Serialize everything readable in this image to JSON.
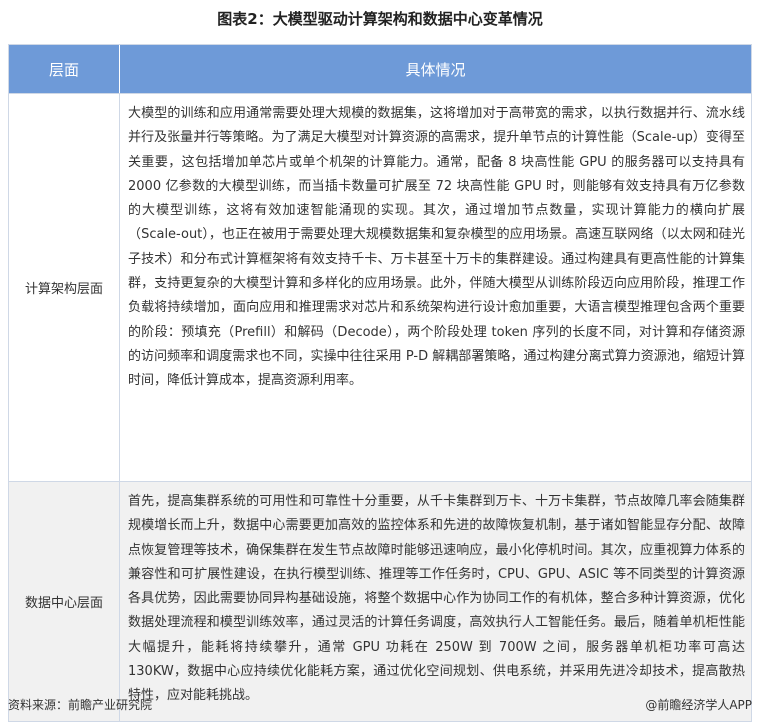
{
  "title": "图表2：大模型驱动计算架构和数据中心变革情况",
  "header": {
    "col1": "层面",
    "col2": "具体情况"
  },
  "rows": [
    {
      "layer": "计算架构层面",
      "detail": "大模型的训练和应用通常需要处理大规模的数据集，这将增加对于高带宽的需求，以执行数据并行、流水线并行及张量并行等策略。为了满足大模型对计算资源的高需求，提升单节点的计算性能（Scale-up）变得至关重要，这包括增加单芯片或单个机架的计算能力。通常，配备 8 块高性能 GPU 的服务器可以支持具有 2000 亿参数的大模型训练，而当插卡数量可扩展至 72 块高性能 GPU 时，则能够有效支持具有万亿参数的大模型训练，这将有效加速智能涌现的实现。其次，通过增加节点数量，实现计算能力的横向扩展（Scale-out），也正在被用于需要处理大规模数据集和复杂模型的应用场景。高速互联网络（以太网和硅光子技术）和分布式计算框架将有效支持千卡、万卡甚至十万卡的集群建设。通过构建具有更高性能的计算集群，支持更复杂的大模型计算和多样化的应用场景。此外，伴随大模型从训练阶段迈向应用阶段，推理工作负载将持续增加，面向应用和推理需求对芯片和系统架构进行设计愈加重要，大语言模型推理包含两个重要的阶段：预填充（Prefill）和解码（Decode），两个阶段处理 token 序列的长度不同，对计算和存储资源的访问频率和调度需求也不同，实操中往往采用 P-D 解耦部署策略，通过构建分离式算力资源池，缩短计算时间，降低计算成本，提高资源利用率。"
    },
    {
      "layer": "数据中心层面",
      "detail": "首先，提高集群系统的可用性和可靠性十分重要，从千卡集群到万卡、十万卡集群，节点故障几率会随集群规模增长而上升，数据中心需要更加高效的监控体系和先进的故障恢复机制，基于诸如智能显存分配、故障点恢复管理等技术，确保集群在发生节点故障时能够迅速响应，最小化停机时间。其次，应重视算力体系的兼容性和可扩展性建设，在执行模型训练、推理等工作任务时，CPU、GPU、ASIC 等不同类型的计算资源各具优势，因此需要协同异构基础设施，将整个数据中心作为协同工作的有机体，整合多种计算资源，优化数据处理流程和模型训练效率，通过灵活的计算任务调度，高效执行人工智能任务。最后，随着单机柜性能大幅提升，能耗将持续攀升，通常 GPU 功耗在 250W 到 700W 之间，服务器单机柜功率可高达 130KW，数据中心应持续优化能耗方案，通过优化空间规划、供电系统，并采用先进冷却技术，提高散热特性，应对能耗挑战。"
    }
  ],
  "footer": {
    "source": "资料来源：前瞻产业研究院",
    "brand": "@前瞻经济学人APP"
  }
}
